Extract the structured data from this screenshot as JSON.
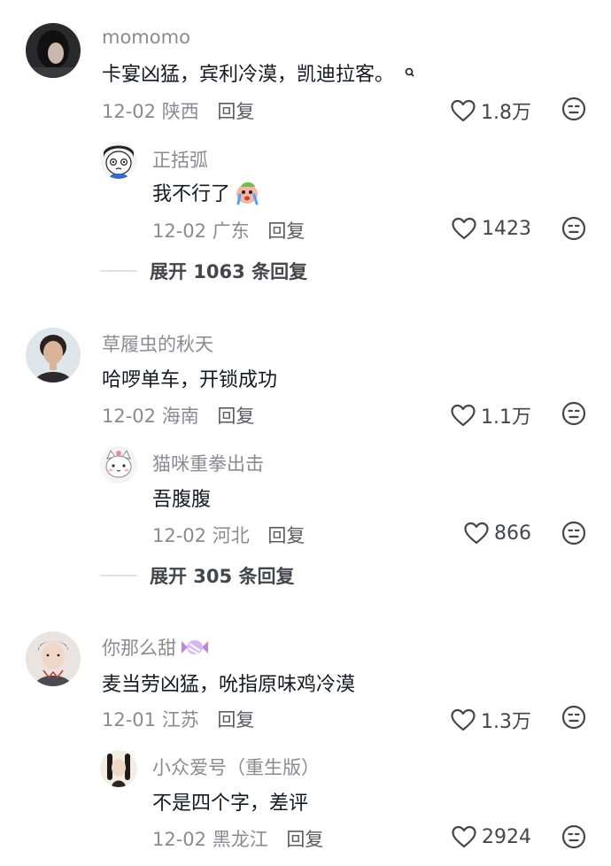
{
  "threads": [
    {
      "comment": {
        "username": "momomo",
        "text": "卡宴凶猛，宾利冷漠，凯迪拉客。",
        "date": "12-02",
        "location": "陕西",
        "reply_label": "回复",
        "likes": "1.8万",
        "avatar_icon": "dark-haired-person-avatar"
      },
      "reply": {
        "username": "正括弧",
        "text": "我不行了",
        "date": "12-02",
        "location": "广东",
        "reply_label": "回复",
        "likes": "1423",
        "avatar_icon": "cartoon-face-avatar",
        "emoji": "crying-emoji"
      },
      "expand_label": "展开 1063 条回复"
    },
    {
      "comment": {
        "username": "草履虫的秋天",
        "text": "哈啰单车，开锁成功",
        "date": "12-02",
        "location": "海南",
        "reply_label": "回复",
        "likes": "1.1万",
        "avatar_icon": "woman-portrait-avatar"
      },
      "reply": {
        "username": "猫咪重拳出击",
        "text": "吾腹腹",
        "date": "12-02",
        "location": "河北",
        "reply_label": "回复",
        "likes": "866",
        "avatar_icon": "cute-cat-avatar"
      },
      "expand_label": "展开 305 条回复"
    },
    {
      "comment": {
        "username": "你那么甜",
        "text": "麦当劳凶猛，吮指原味鸡冷漠",
        "date": "12-01",
        "location": "江苏",
        "reply_label": "回复",
        "likes": "1.3万",
        "avatar_icon": "illustrated-man-avatar",
        "emoji": "candy-emoji"
      },
      "reply": {
        "username": "小众爱号（重生版）",
        "text": "不是四个字，差评",
        "date": "12-02",
        "location": "黑龙江",
        "reply_label": "回复",
        "likes": "2924",
        "avatar_icon": "doll-avatar"
      }
    }
  ],
  "colors": {
    "username": "#8a8b91",
    "text": "#161823",
    "meta": "#8a8b91"
  }
}
